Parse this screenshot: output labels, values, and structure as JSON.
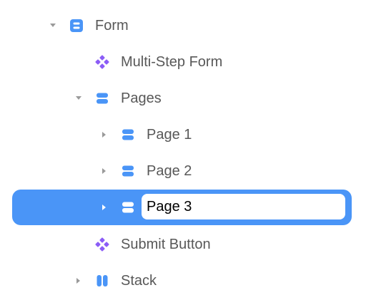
{
  "colors": {
    "label_text": "#585858",
    "icon_blue": "#4A95F7",
    "icon_purple": "#8B5CF6",
    "caret": "#9a9a9a",
    "selection": "#4A95F7",
    "edit_text": "#000000"
  },
  "tree": {
    "form": {
      "label": "Form",
      "icon": "form-icon",
      "expanded": true
    },
    "multi_step_form": {
      "label": "Multi-Step Form",
      "icon": "component-icon"
    },
    "pages": {
      "label": "Pages",
      "icon": "stack-icon",
      "expanded": true
    },
    "page1": {
      "label": "Page 1",
      "icon": "stack-icon",
      "expanded": false
    },
    "page2": {
      "label": "Page 2",
      "icon": "stack-icon",
      "expanded": false
    },
    "page3": {
      "value": "Page 3",
      "icon": "stack-icon",
      "expanded": false,
      "selected": true,
      "editing": true
    },
    "submit_button": {
      "label": "Submit Button",
      "icon": "component-icon"
    },
    "stack": {
      "label": "Stack",
      "icon": "columns-icon",
      "expanded": false
    }
  }
}
